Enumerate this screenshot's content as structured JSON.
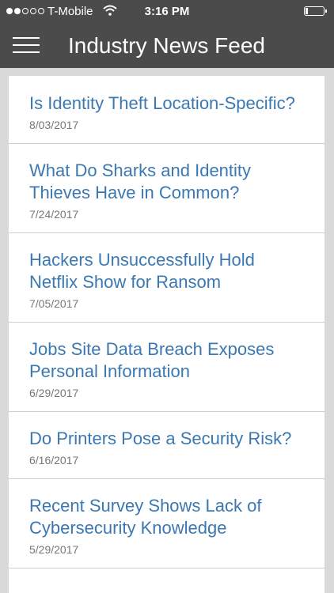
{
  "status_bar": {
    "carrier": "T-Mobile",
    "time": "3:16 PM",
    "signal_bars": 2,
    "signal_total": 5,
    "battery_level": 0.15
  },
  "nav": {
    "title": "Industry News Feed",
    "menu_icon": "hamburger-menu-icon"
  },
  "colors": {
    "bar_background": "#4b4b4b",
    "link": "#3b78b1",
    "date": "#777777",
    "page_background": "#d9d9d9"
  },
  "feed": {
    "items": [
      {
        "title": "Is Identity Theft Location-Specific?",
        "date": "8/03/2017"
      },
      {
        "title": "What Do Sharks and Identity Thieves Have in Common?",
        "date": "7/24/2017"
      },
      {
        "title": "Hackers Unsuccessfully Hold Netflix Show for Ransom",
        "date": "7/05/2017"
      },
      {
        "title": "Jobs Site Data Breach Exposes Personal Information",
        "date": "6/29/2017"
      },
      {
        "title": "Do Printers Pose a Security Risk?",
        "date": "6/16/2017"
      },
      {
        "title": "Recent Survey Shows Lack of Cybersecurity Knowledge",
        "date": "5/29/2017"
      }
    ]
  }
}
